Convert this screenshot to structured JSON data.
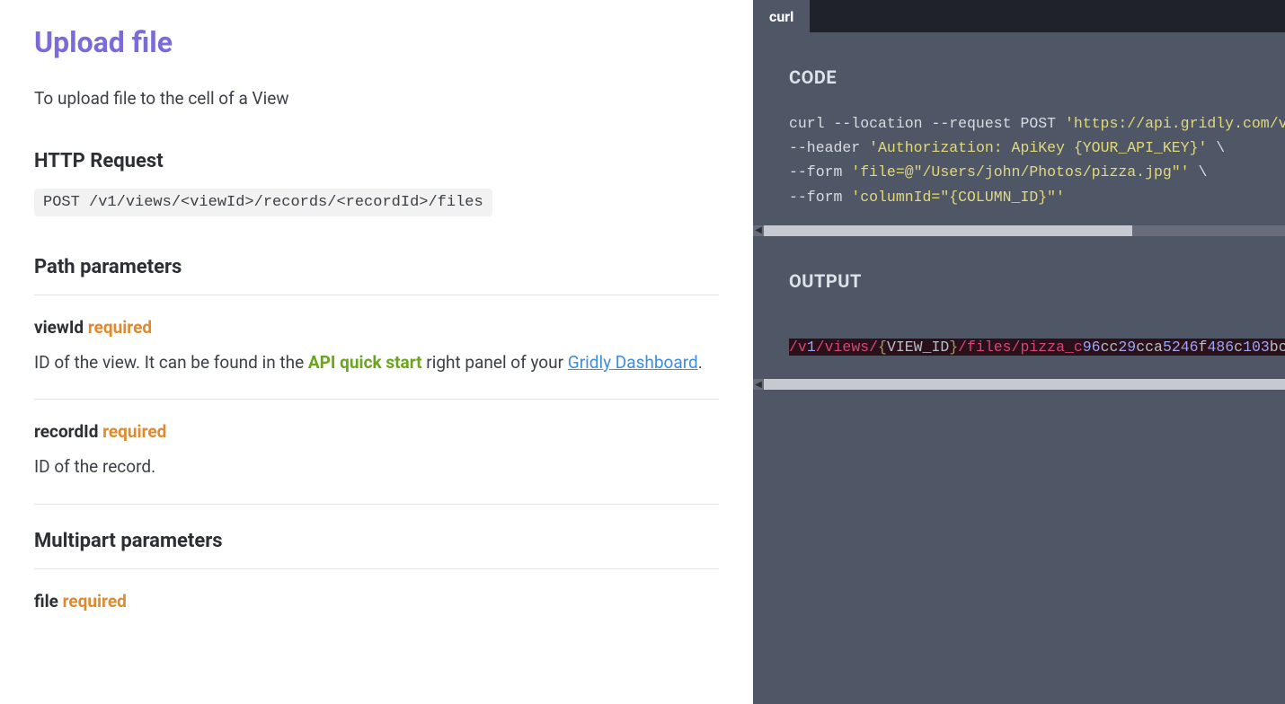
{
  "left": {
    "title": "Upload file",
    "intro": "To upload file to the cell of a View",
    "httpRequestHeading": "HTTP Request",
    "httpRequestCode": "POST /v1/views/<viewId>/records/<recordId>/files",
    "pathParamsHeading": "Path parameters",
    "params": {
      "viewId": {
        "name": "viewId",
        "required": "required",
        "desc_pre": "ID of the view. It can be found in the ",
        "desc_api": "API quick start",
        "desc_mid": " right panel of your ",
        "desc_link": "Gridly Dashboard",
        "desc_post": "."
      },
      "recordId": {
        "name": "recordId",
        "required": "required",
        "desc": "ID of the record."
      }
    },
    "multipartHeading": "Multipart parameters",
    "fileParam": {
      "name": "file",
      "required": "required"
    }
  },
  "right": {
    "tab": "curl",
    "codeLabel": "CODE",
    "code": {
      "l1a": "curl --location --request POST ",
      "l1b": "'https://api.gridly.com/v",
      "l2a": "--header ",
      "l2b": "'Authorization: ApiKey {YOUR_API_KEY}'",
      "l2c": " \\",
      "l3a": "--form ",
      "l3b": "'file=@\"/Users/john/Photos/pizza.jpg\"'",
      "l3c": " \\",
      "l4a": "--form ",
      "l4b": "'columnId=\"{COLUMN_ID}\"'"
    },
    "outputLabel": "OUTPUT",
    "output": {
      "s1": "/v",
      "s2": "1",
      "s3": "/views/",
      "s4": "{",
      "s5": "VIEW_ID",
      "s6": "}",
      "s7": "/files/pizza_c",
      "s8": "96",
      "s9": "cc",
      "s10": "29",
      "s11": "cca",
      "s12": "5246",
      "s13": "f",
      "s14": "486",
      "s15": "c",
      "s16": "103",
      "s17": "bc"
    }
  }
}
